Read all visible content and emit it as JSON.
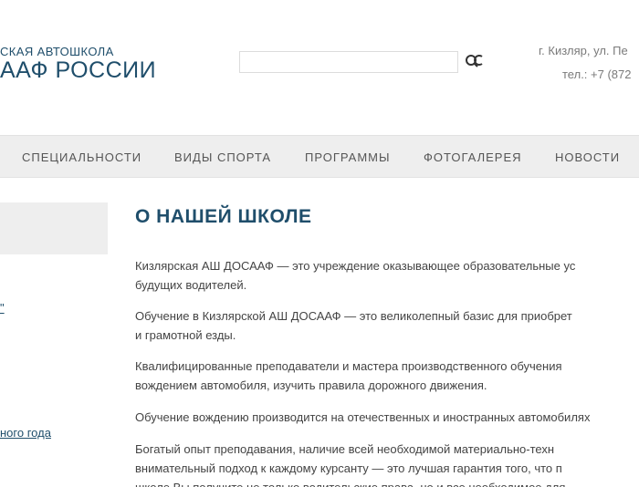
{
  "header": {
    "logo_sub": "СКАЯ АВТОШКОЛА",
    "logo_main": "ААФ РОССИИ",
    "search_placeholder": "",
    "address": "г. Кизляр, ул. Пе",
    "phone": "тел.: +7 (872"
  },
  "nav": {
    "items": [
      "СПЕЦИАЛЬНОСТИ",
      "ВИДЫ СПОРТА",
      "ПРОГРАММЫ",
      "ФОТОГАЛЕРЕЯ",
      "НОВОСТИ"
    ]
  },
  "sidebar": {
    "link1": "\"",
    "link2": "ного года"
  },
  "content": {
    "title": "О НАШЕЙ ШКОЛЕ",
    "p1_l1": "Кизлярская АШ ДОСААФ — это учреждение оказывающее образовательные ус",
    "p1_l2": "будущих водителей.",
    "p2_l1": "Обучение в Кизлярской АШ ДОСААФ — это великолепный базис для приобрет",
    "p2_l2": "и грамотной езды.",
    "p3_l1": "Квалифицированные   преподаватели   и   мастера   производственного   обучения",
    "p3_l2": "вождением автомобиля, изучить правила дорожного движения.",
    "p4_l1": "Обучение вождению производится на отечественных и иностранных автомобилях",
    "p5_l1": "Богатый   опыт   преподавания,   наличие   всей   необходимой   материально-техн",
    "p5_l2": "внимательный подход к каждому курсанту — это лучшая гарантия того, что п",
    "p5_l3": "школе Вы получите не только водительские права, но и все необходимое для"
  },
  "colors": {
    "brand": "#1f4e6b",
    "nav_bg": "#eeeeee",
    "text": "#444444"
  }
}
